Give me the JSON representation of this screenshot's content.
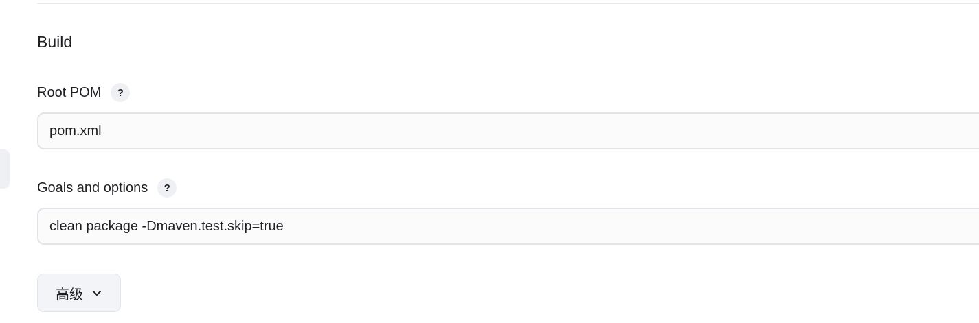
{
  "section": {
    "title": "Build"
  },
  "root_pom": {
    "label": "Root POM",
    "help": "?",
    "value": "pom.xml"
  },
  "goals": {
    "label": "Goals and options",
    "help": "?",
    "value": "clean package -Dmaven.test.skip=true"
  },
  "advanced": {
    "label": "高级",
    "icon": "chevron-down-icon"
  }
}
